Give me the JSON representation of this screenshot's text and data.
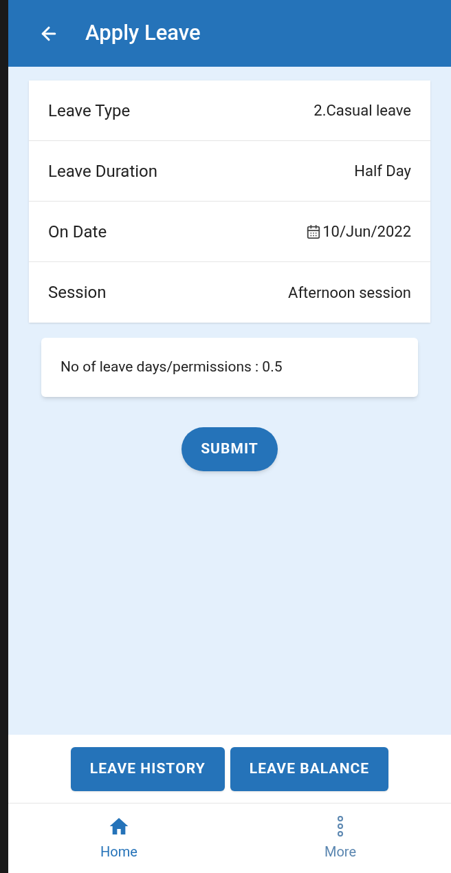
{
  "header": {
    "title": "Apply Leave"
  },
  "fields": [
    {
      "label": "Leave Type",
      "value": "2.Casual leave",
      "kind": "text"
    },
    {
      "label": "Leave Duration",
      "value": "Half Day",
      "kind": "text"
    },
    {
      "label": "On Date",
      "value": "10/Jun/2022",
      "kind": "date"
    },
    {
      "label": "Session",
      "value": "Afternoon session",
      "kind": "text"
    }
  ],
  "summary": "No of leave days/permissions : 0.5",
  "submit": "SUBMIT",
  "actions": [
    "LEAVE HISTORY",
    "LEAVE BALANCE"
  ],
  "nav": [
    {
      "label": "Home",
      "kind": "home",
      "selected": true
    },
    {
      "label": "More",
      "kind": "more",
      "selected": false
    }
  ]
}
